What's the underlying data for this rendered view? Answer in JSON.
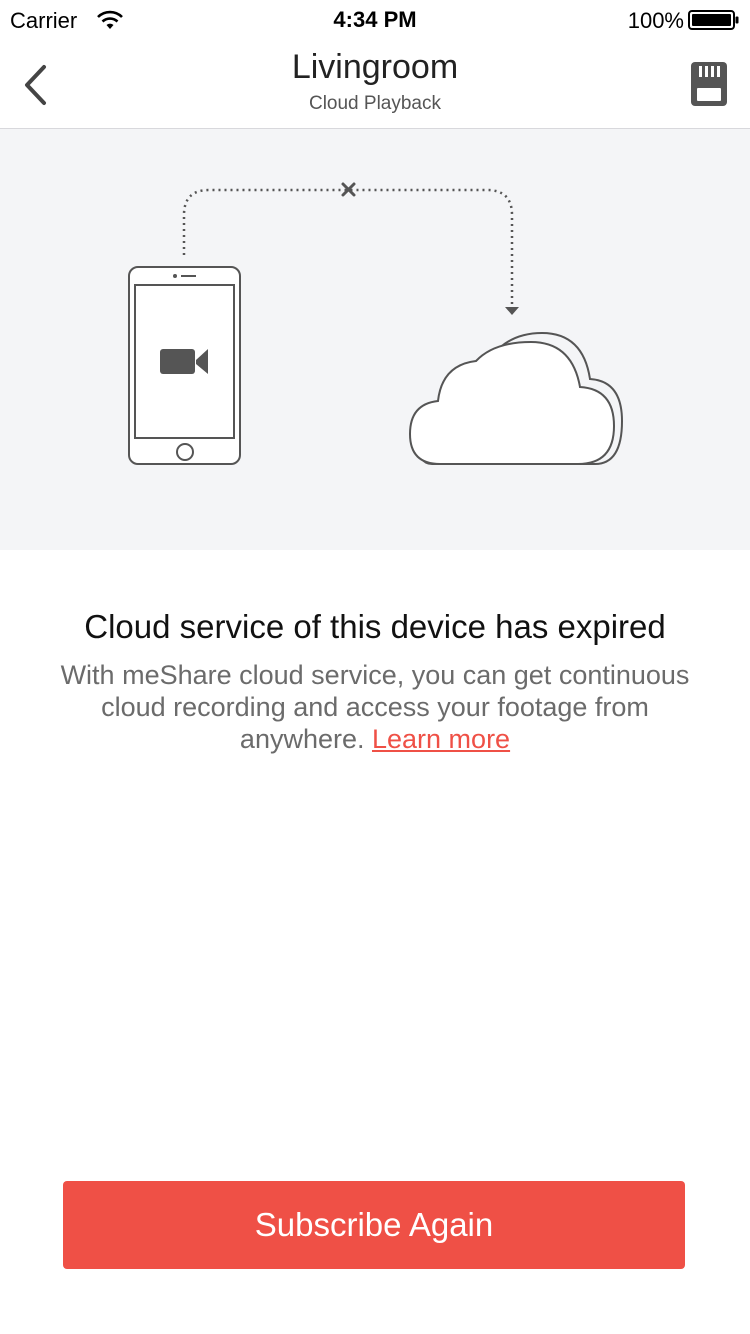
{
  "status_bar": {
    "carrier": "Carrier",
    "time": "4:34 PM",
    "battery": "100%"
  },
  "nav": {
    "title": "Livingroom",
    "subtitle": "Cloud Playback",
    "back_icon": "chevron-left-icon",
    "right_icon": "sd-card-icon"
  },
  "message": {
    "headline": "Cloud service of this device has expired",
    "body": "With meShare cloud service, you can get continuous cloud recording and access your footage from anywhere. ",
    "link": "Learn more"
  },
  "action": {
    "subscribe_label": "Subscribe Again"
  },
  "colors": {
    "accent": "#ef5046",
    "illustration_bg": "#f4f5f7"
  }
}
